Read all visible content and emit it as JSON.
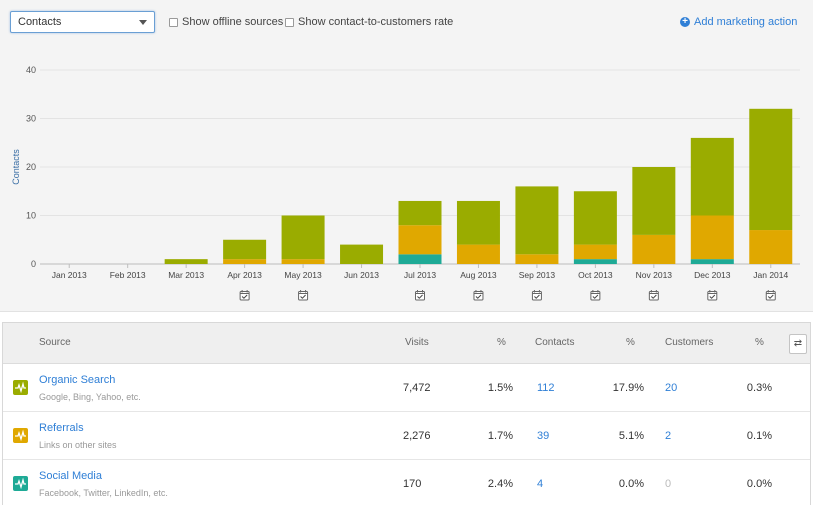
{
  "toolbar": {
    "metric_select": "Contacts",
    "show_offline_label": "Show offline sources",
    "show_rate_label": "Show contact-to-customers rate",
    "add_action_label": "Add marketing action"
  },
  "chart_data": {
    "type": "bar",
    "stacked": true,
    "ylabel": "Contacts",
    "ylim": [
      0,
      40
    ],
    "yticks": [
      "0",
      "10",
      "20",
      "30",
      "40"
    ],
    "categories": [
      "Jan 2013",
      "Feb 2013",
      "Mar 2013",
      "Apr 2013",
      "May 2013",
      "Jun 2013",
      "Jul 2013",
      "Aug 2013",
      "Sep 2013",
      "Oct 2013",
      "Nov 2013",
      "Dec 2013",
      "Jan 2014"
    ],
    "series": [
      {
        "name": "Social Media",
        "color": "#1eaa96",
        "values": [
          0,
          0,
          0,
          0,
          0,
          0,
          2,
          0,
          0,
          1,
          0,
          1,
          0
        ]
      },
      {
        "name": "Referrals",
        "color": "#e0a800",
        "values": [
          0,
          0,
          0,
          1,
          1,
          0,
          6,
          4,
          2,
          3,
          6,
          9,
          7
        ]
      },
      {
        "name": "Organic Search",
        "color": "#9aac00",
        "values": [
          0,
          0,
          1,
          4,
          9,
          4,
          5,
          9,
          14,
          11,
          14,
          16,
          25
        ]
      }
    ],
    "action_markers": [
      false,
      false,
      false,
      true,
      true,
      false,
      true,
      true,
      true,
      true,
      true,
      true,
      true
    ],
    "marker_icon": "calendar-check-icon"
  },
  "table": {
    "headers": {
      "source": "Source",
      "visits": "Visits",
      "visits_pct": "%",
      "contacts": "Contacts",
      "contacts_pct": "%",
      "customers": "Customers",
      "customers_pct": "%"
    },
    "swap_icon": "swap-arrows-icon",
    "rows": [
      {
        "name": "Organic Search",
        "sub": "Google, Bing, Yahoo, etc.",
        "color": "#9aac00",
        "visits": "7,472",
        "visits_pct": "1.5%",
        "contacts": "112",
        "contacts_pct": "17.9%",
        "customers": "20",
        "customers_pct": "0.3%"
      },
      {
        "name": "Referrals",
        "sub": "Links on other sites",
        "color": "#e0a800",
        "visits": "2,276",
        "visits_pct": "1.7%",
        "contacts": "39",
        "contacts_pct": "5.1%",
        "customers": "2",
        "customers_pct": "0.1%"
      },
      {
        "name": "Social Media",
        "sub": "Facebook, Twitter, LinkedIn, etc.",
        "color": "#1eaa96",
        "visits": "170",
        "visits_pct": "2.4%",
        "contacts": "4",
        "contacts_pct": "0.0%",
        "customers": "0",
        "customers_pct": "0.0%"
      }
    ]
  }
}
